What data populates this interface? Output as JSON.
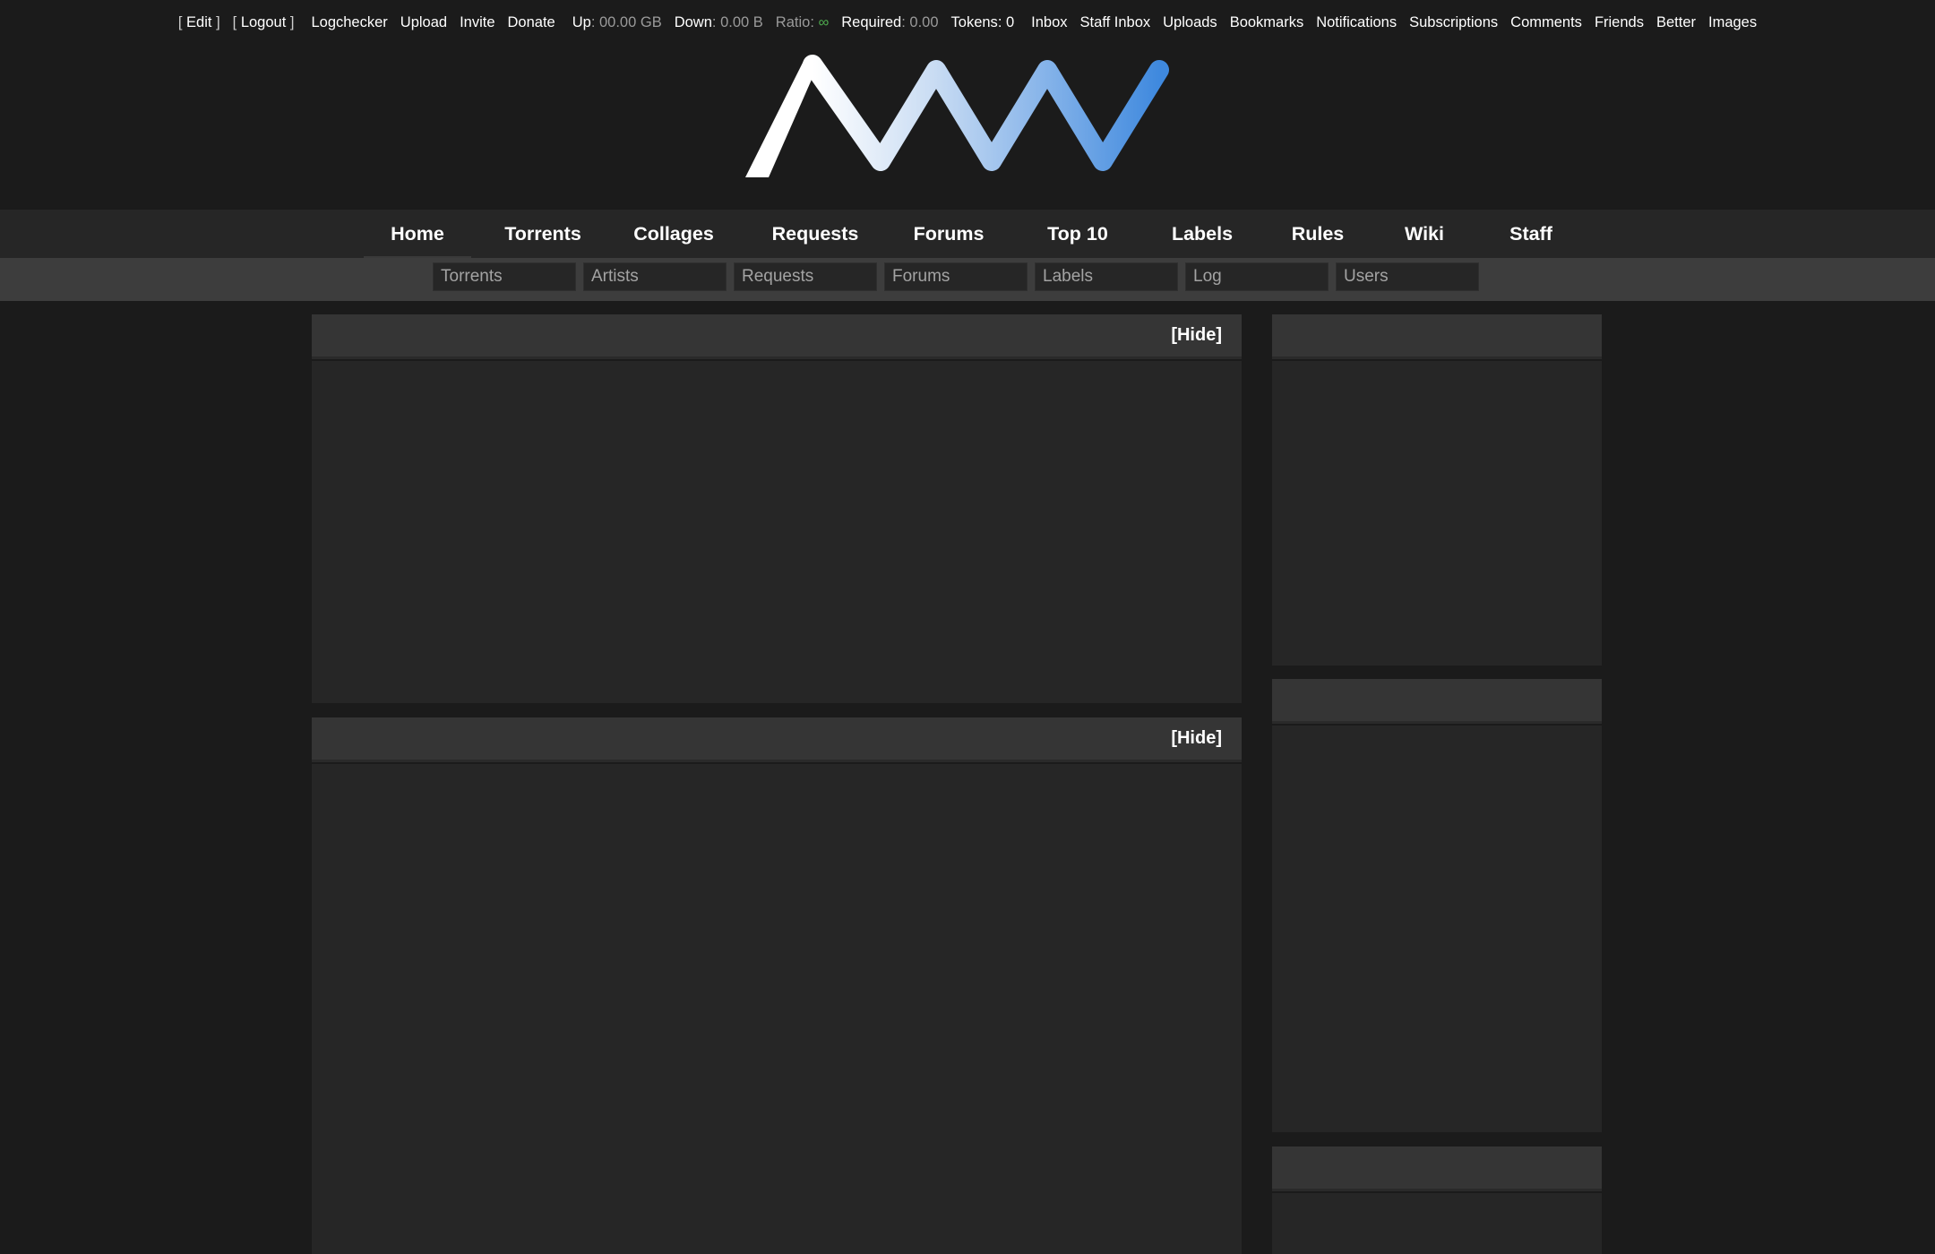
{
  "userbar": {
    "edit": "Edit",
    "logout": "Logout",
    "links": [
      "Logchecker",
      "Upload",
      "Invite",
      "Donate"
    ],
    "up_label": "Up",
    "up_value": "00.00 GB",
    "down_label": "Down",
    "down_value": "0.00 B",
    "ratio_label": "Ratio",
    "ratio_value": "∞",
    "required_label": "Required",
    "required_value": "0.00",
    "tokens_label": "Tokens",
    "tokens_value": "0",
    "right_links": [
      "Inbox",
      "Staff Inbox",
      "Uploads",
      "Bookmarks",
      "Notifications",
      "Subscriptions",
      "Comments",
      "Friends",
      "Better",
      "Images"
    ]
  },
  "logo": {
    "icon": "zigzag-wave-logo",
    "colors": [
      "#ffffff",
      "#c5d9f2",
      "#8db8ea",
      "#4a8fe0"
    ]
  },
  "mainnav": {
    "items": [
      "Home",
      "Torrents",
      "Collages",
      "Requests",
      "Forums",
      "Top 10",
      "Labels",
      "Rules",
      "Wiki",
      "Staff"
    ],
    "active": "Home"
  },
  "search": {
    "placeholders": [
      "Torrents",
      "Artists",
      "Requests",
      "Forums",
      "Labels",
      "Log",
      "Users"
    ]
  },
  "main": {
    "panels": [
      {
        "hide_label": "[Hide]"
      },
      {
        "hide_label": "[Hide]"
      }
    ]
  },
  "colors": {
    "background": "#1b1b1b",
    "nav": "#262626",
    "search_bar": "#3d3d3d",
    "panel_head": "#353535",
    "panel_body": "#262626",
    "ratio": "#4fae4f"
  }
}
